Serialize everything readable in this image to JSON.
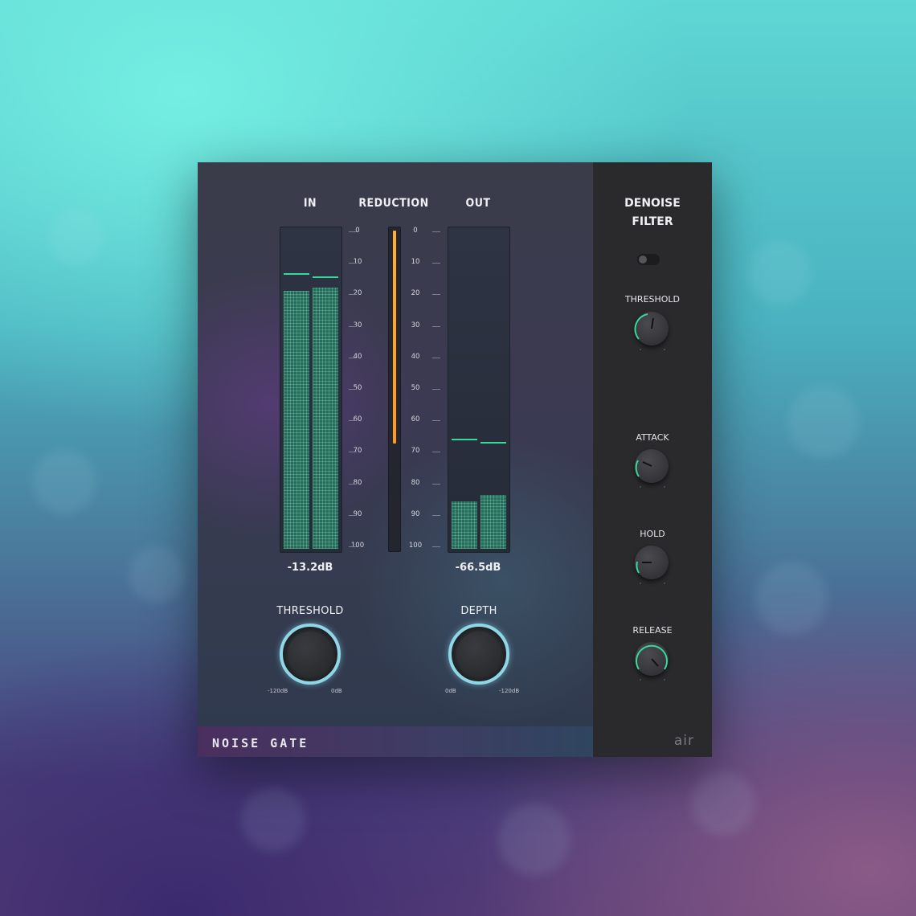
{
  "plugin": {
    "name": "NOISE GATE",
    "logo": "air",
    "meters": {
      "in_label": "IN",
      "reduction_label": "REDUCTION",
      "out_label": "OUT",
      "scale": [
        "0",
        "10",
        "20",
        "30",
        "40",
        "50",
        "60",
        "70",
        "80",
        "90",
        "100"
      ],
      "in_readout": "-13.2dB",
      "out_readout": "-66.5dB",
      "in_levels": [
        0.81,
        0.82
      ],
      "in_peaks": [
        0.86,
        0.85
      ],
      "out_levels": [
        0.15,
        0.17
      ],
      "out_peaks": [
        0.34,
        0.33
      ],
      "reduction_level": 0.67
    },
    "threshold": {
      "label": "THRESHOLD",
      "min_label": "-120dB",
      "max_label": "0dB"
    },
    "depth": {
      "label": "DEPTH",
      "min_label": "0dB",
      "max_label": "-120dB"
    },
    "sidebar": {
      "title": "DENOISE\nFILTER",
      "threshold_label": "THRESHOLD",
      "attack_label": "ATTACK",
      "hold_label": "HOLD",
      "release_label": "RELEASE"
    },
    "colors": {
      "accent_green": "#35d99a",
      "accent_cyan": "#8fd6e6",
      "reduction_orange": "#ffa824"
    }
  }
}
